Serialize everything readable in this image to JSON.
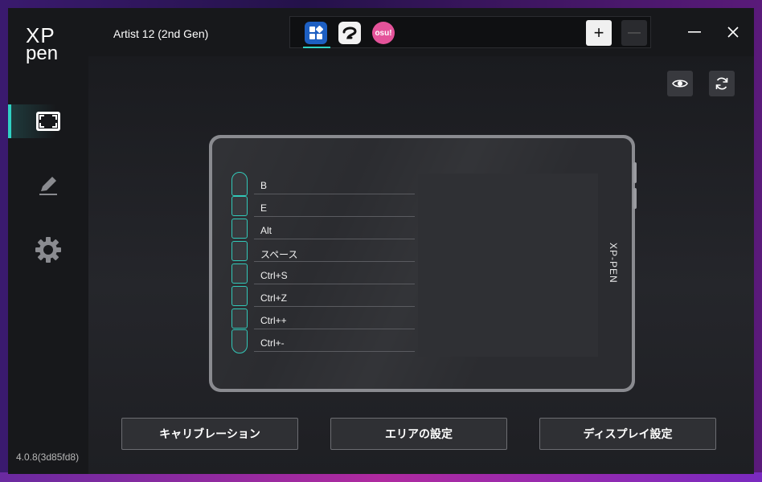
{
  "app": {
    "brand_line1": "XP",
    "brand_line2": "pen",
    "version": "4.0.8(3d85fd8)"
  },
  "header": {
    "device_name": "Artist 12 (2nd Gen)",
    "apps": [
      {
        "name": "apps-grid-icon",
        "label": ""
      },
      {
        "name": "clip-studio-icon",
        "label": ""
      },
      {
        "name": "osu-icon",
        "label": "osu!"
      }
    ],
    "add_label": "+",
    "remove_label": "—"
  },
  "tablet": {
    "brand_vertical": "XP-PEN",
    "keys": [
      "B",
      "E",
      "Alt",
      "スペース",
      "Ctrl+S",
      "Ctrl+Z",
      "Ctrl++",
      "Ctrl+-"
    ]
  },
  "actions": {
    "calibration": "キャリブレーション",
    "area_settings": "エリアの設定",
    "display_settings": "ディスプレイ設定"
  },
  "colors": {
    "accent": "#2fd1c4",
    "osu": "#e4539a",
    "apps_blue": "#1d5fc2"
  }
}
